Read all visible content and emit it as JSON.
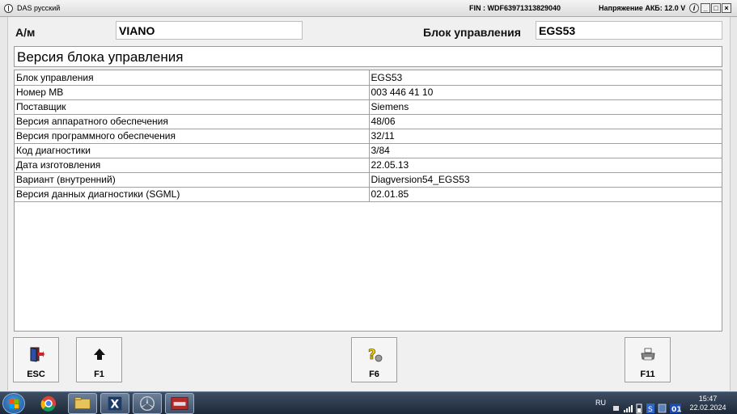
{
  "window": {
    "title": "DAS русский",
    "fin": "FIN : WDF63971313829040",
    "voltage": "Напряжение АКБ: 12.0 V",
    "buttons": {
      "info": "i",
      "minimize": "_",
      "maximize": "□",
      "close": "×"
    }
  },
  "header": {
    "vehicle_label": "А/м",
    "vehicle_value": "VIANO",
    "ecu_label": "Блок управления",
    "ecu_value": "EGS53"
  },
  "section_title": "Версия блока управления",
  "table": {
    "rows": [
      {
        "label": "Блок управления",
        "value": "EGS53"
      },
      {
        "label": "Номер MB",
        "value": "003 446 41 10"
      },
      {
        "label": "Поставщик",
        "value": "Siemens"
      },
      {
        "label": "Версия аппаратного обеспечения",
        "value": "48/06"
      },
      {
        "label": "Версия программного обеспечения",
        "value": "32/11"
      },
      {
        "label": "Код диагностики",
        "value": "3/84"
      },
      {
        "label": "Дата изготовления",
        "value": "22.05.13"
      },
      {
        "label": "Вариант (внутренний)",
        "value": "Diagversion54_EGS53"
      },
      {
        "label": "Версия данных диагностики (SGML)",
        "value": "02.01.85"
      }
    ]
  },
  "function_keys": {
    "esc": {
      "label": "ESC",
      "icon": "exit-door-icon"
    },
    "f1": {
      "label": "F1",
      "icon": "arrow-up-icon"
    },
    "f6": {
      "label": "F6",
      "icon": "help-question-icon"
    },
    "f11": {
      "label": "F11",
      "icon": "printer-icon"
    }
  },
  "taskbar": {
    "apps": [
      "start-orb",
      "chrome-icon",
      "file-explorer-icon",
      "xentry-icon",
      "mercedes-star-icon",
      "das-car-icon"
    ],
    "language": "RU",
    "time": "15:47",
    "date": "22.02.2024"
  },
  "colors": {
    "taskbar": "#2b3a4e",
    "window_bg": "#f0f0f0",
    "help_icon": "#f2d200"
  }
}
